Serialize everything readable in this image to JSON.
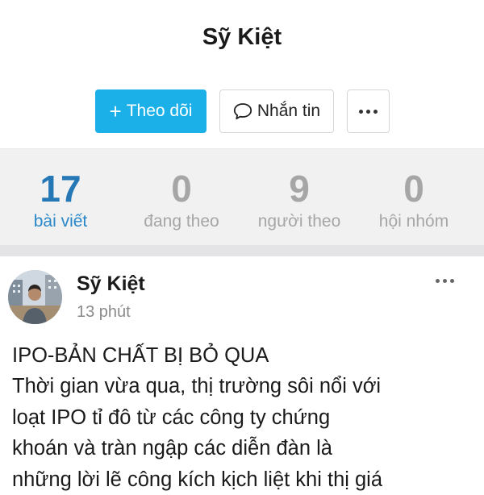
{
  "profile": {
    "name": "Sỹ Kiệt",
    "follow_label": "Theo dõi",
    "follow_icon": "plus-icon",
    "message_label": "Nhắn tin",
    "message_icon": "speech-bubble-icon",
    "more_icon": "ellipsis-icon",
    "accent_color": "#1bb0e8"
  },
  "stats": [
    {
      "value": "17",
      "label": "bài viết",
      "active": true
    },
    {
      "value": "0",
      "label": "đang theo",
      "active": false
    },
    {
      "value": "9",
      "label": "người theo",
      "active": false
    },
    {
      "value": "0",
      "label": "hội nhóm",
      "active": false
    }
  ],
  "post": {
    "author": "Sỹ Kiệt",
    "time": "13 phút",
    "avatar": "user-avatar",
    "more_icon": "ellipsis-icon",
    "lines": [
      "IPO-BẢN CHẤT BỊ BỎ QUA",
      "Thời gian vừa qua, thị trường sôi nổi với",
      "loạt IPO tỉ đô từ các công ty chứng",
      "khoán và tràn ngập các diễn đàn là",
      "những lời lẽ công kích kịch liệt khi thị giá"
    ]
  }
}
